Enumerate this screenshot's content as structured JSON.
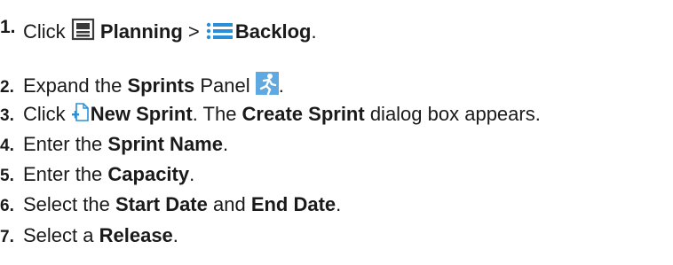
{
  "steps": [
    {
      "num": "1.",
      "parts": {
        "a": "Click ",
        "b1": "Planning",
        "sep": " > ",
        "b2": "Backlog",
        "end": "."
      },
      "icons": [
        "planning-icon",
        "backlog-icon"
      ]
    },
    {
      "num": "2.",
      "parts": {
        "a": "Expand the ",
        "b1": "Sprints",
        "c": " Panel ",
        "end": "."
      },
      "icons": [
        "sprint-runner-icon"
      ]
    },
    {
      "num": "3.",
      "parts": {
        "a": "Click ",
        "b1": "New Sprint",
        "c": ". The ",
        "b2": "Create Sprint",
        "end": " dialog box appears."
      },
      "icons": [
        "new-sprint-icon"
      ]
    },
    {
      "num": "4.",
      "parts": {
        "a": "Enter the ",
        "b1": "Sprint Name",
        "end": "."
      }
    },
    {
      "num": "5.",
      "parts": {
        "a": "Enter the ",
        "b1": "Capacity",
        "end": "."
      }
    },
    {
      "num": "6.",
      "parts": {
        "a": "Select the ",
        "b1": "Start Date",
        "c": " and ",
        "b2": "End Date",
        "end": "."
      }
    },
    {
      "num": "7.",
      "parts": {
        "a": "Select a ",
        "b1": "Release",
        "end": "."
      }
    }
  ],
  "colors": {
    "text": "#1a1a1a",
    "icon_blue": "#2b8fd6",
    "icon_dark": "#3a3a3a"
  }
}
